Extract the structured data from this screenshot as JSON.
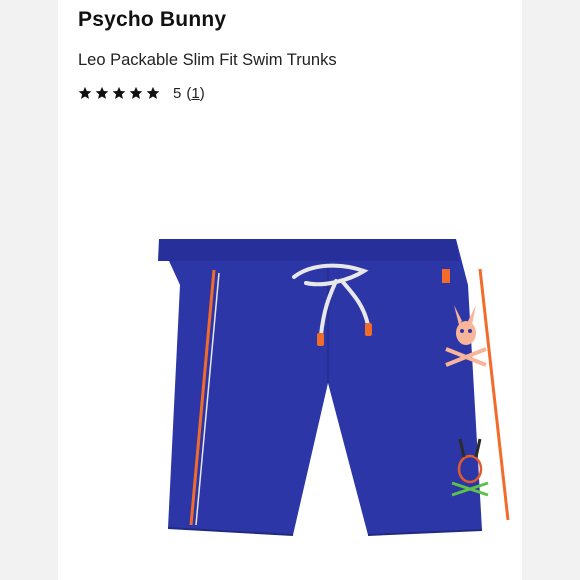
{
  "product": {
    "brand": "Psycho Bunny",
    "title": "Leo Packable Slim Fit Swim Trunks",
    "rating": {
      "value": "5",
      "review_count": "1",
      "stars_filled": 5,
      "stars_total": 5
    },
    "image": {
      "description_icon": "swim-trunks-image",
      "main_color": "#2d36a6",
      "trim_color": "#f26b2a",
      "drawcord_color": "#e8e8e8"
    }
  },
  "colors": {
    "background": "#ffffff",
    "side_panels": "#f2f2f2",
    "text": "#1a1a1a",
    "star": "#111111"
  }
}
